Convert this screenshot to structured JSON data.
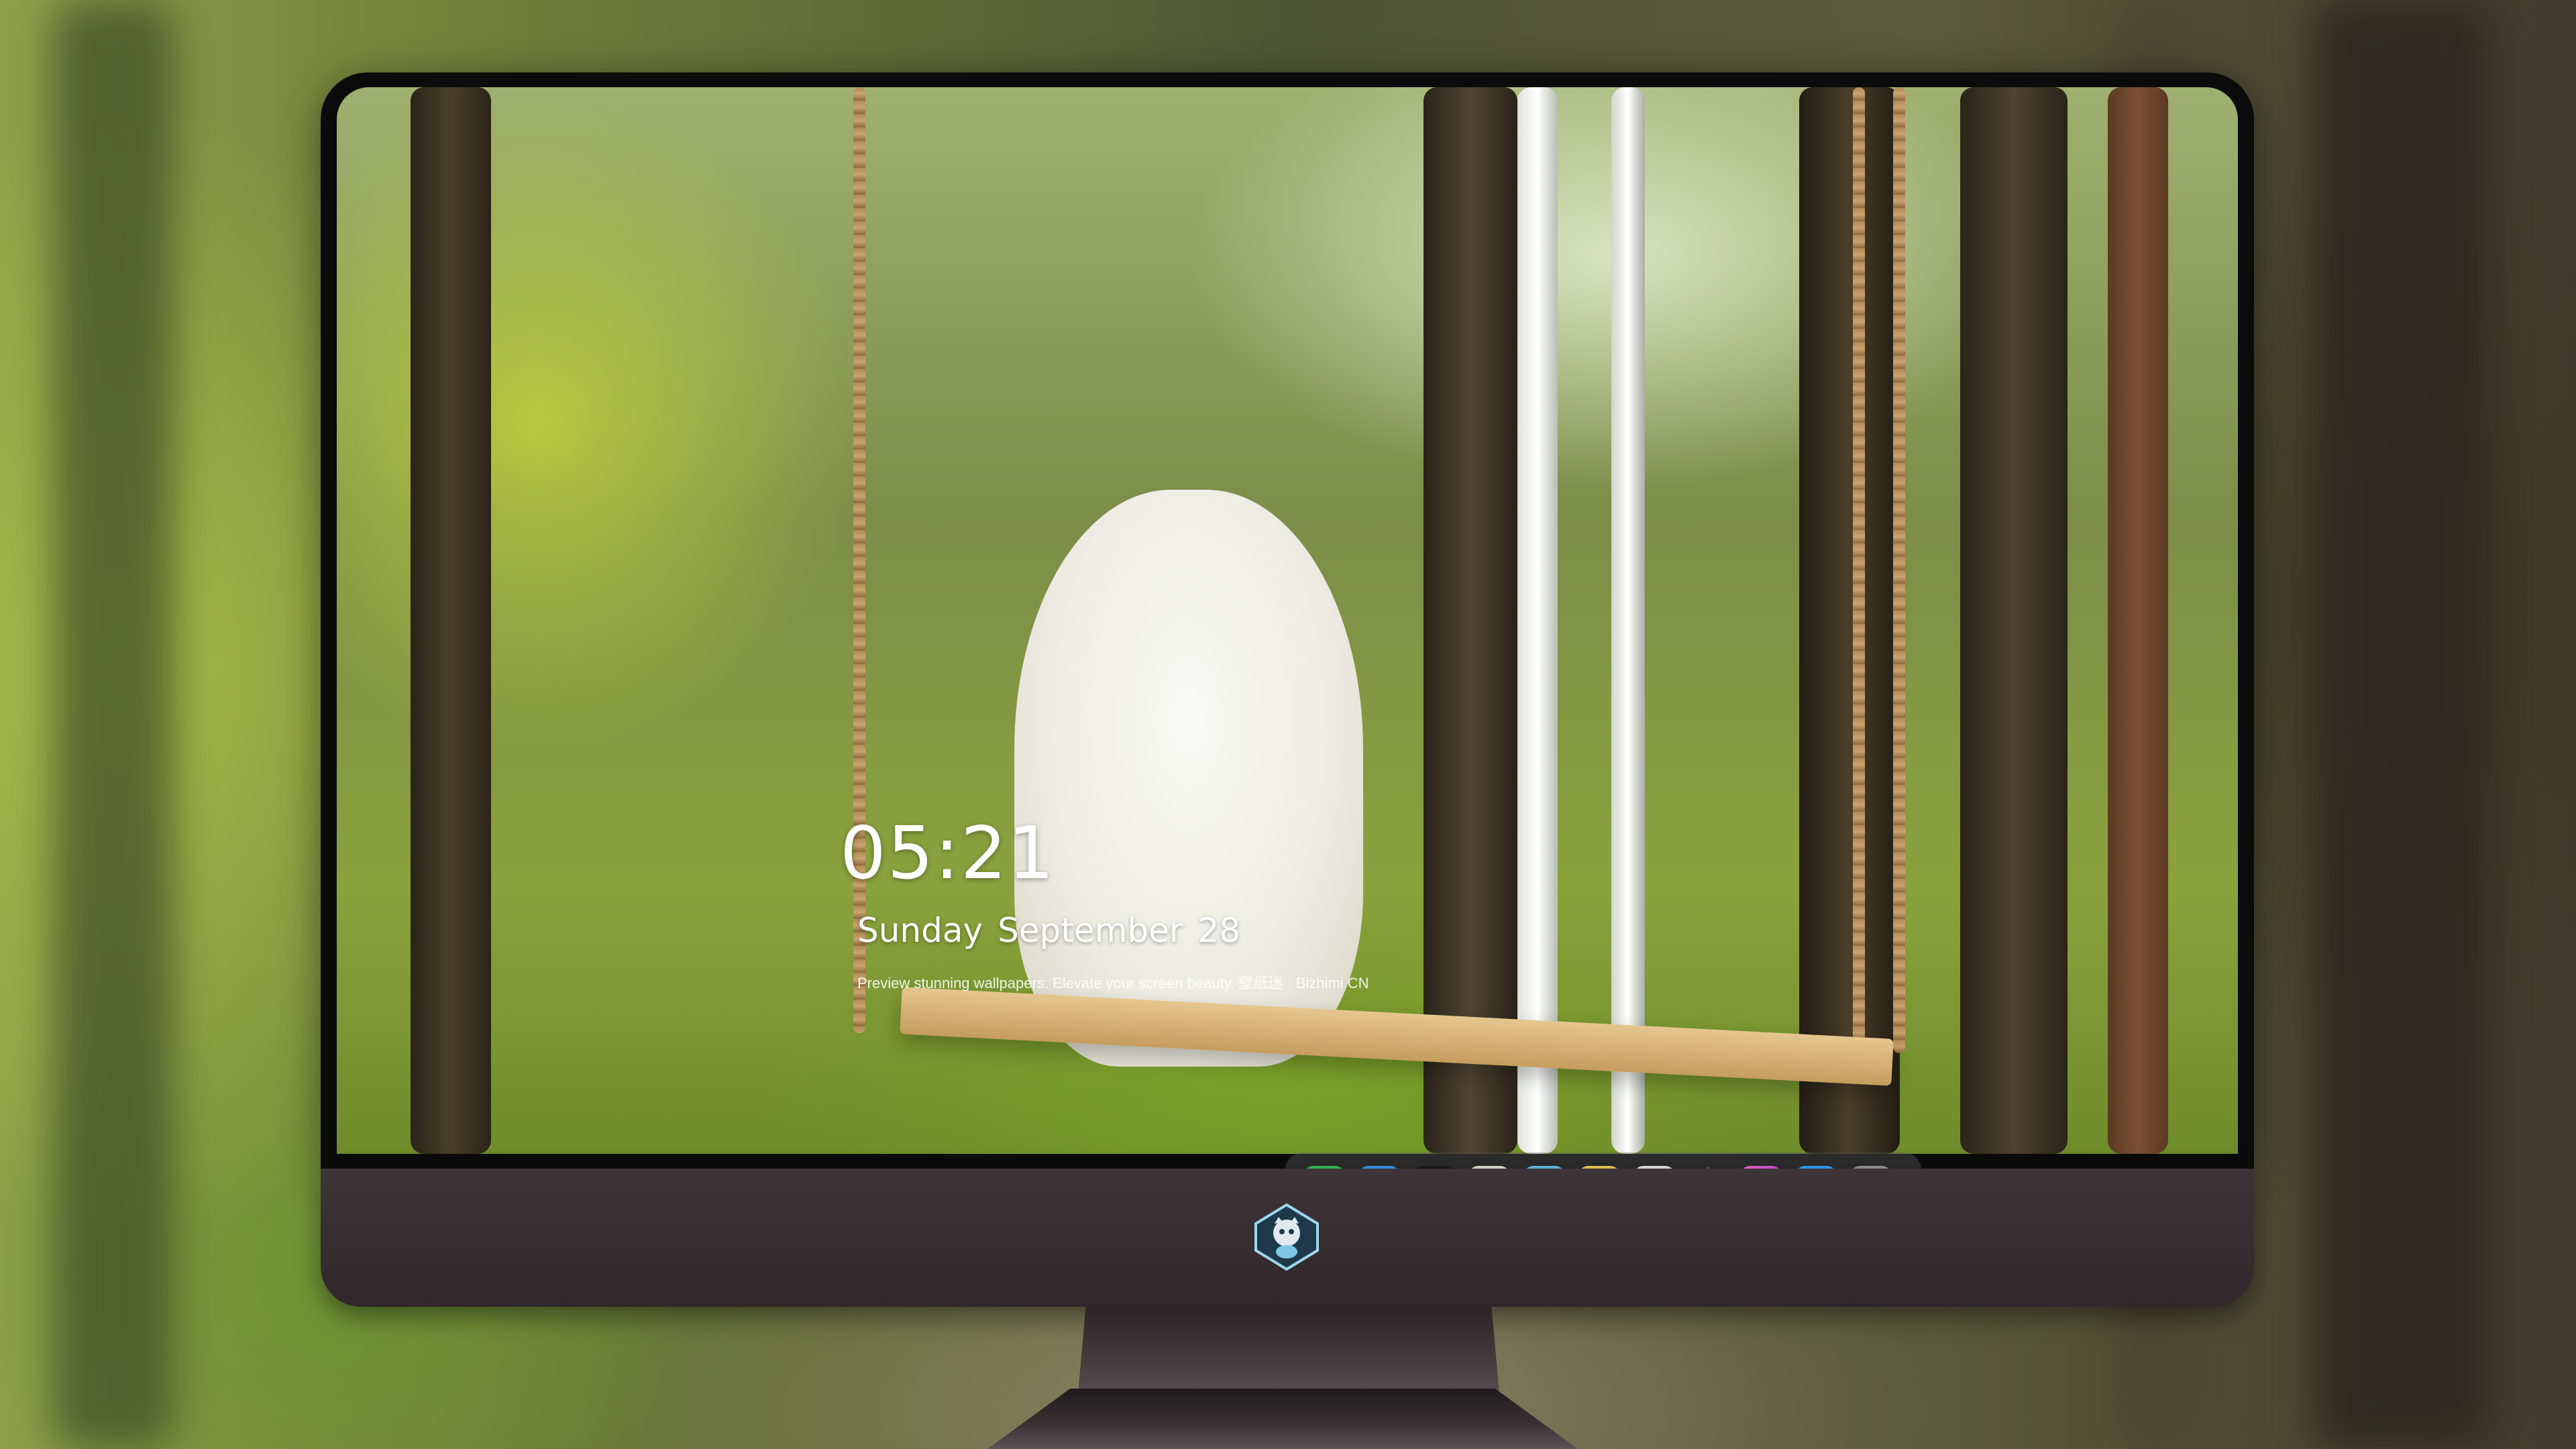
{
  "lockscreen": {
    "time": "05:21",
    "weekday": "Sunday",
    "month": "September",
    "day": "28",
    "tagline": "Preview stunning wallpapers. Elevate your screen beauty. 壁纸迷 · Bizhimi CN"
  },
  "dock": {
    "apps": [
      {
        "name": "messages-icon",
        "color": "#34c759"
      },
      {
        "name": "weather-icon",
        "color": "#2f8ef0"
      },
      {
        "name": "clock-icon",
        "color": "#1c1c1e"
      },
      {
        "name": "preview-icon",
        "color": "#e9e4d8"
      },
      {
        "name": "video-clapper-icon",
        "color": "#4aa8e8"
      },
      {
        "name": "notes-icon",
        "color": "#f6d35a"
      },
      {
        "name": "photo-booth-icon",
        "color": "#eaeaea"
      },
      {
        "name": "itunes-icon",
        "color": "#e055d6"
      },
      {
        "name": "app-store-icon",
        "color": "#1f8ff5"
      },
      {
        "name": "camera-icon",
        "color": "#8a8a8e"
      }
    ]
  },
  "monitor": {
    "logo": "brand-logo-icon"
  }
}
